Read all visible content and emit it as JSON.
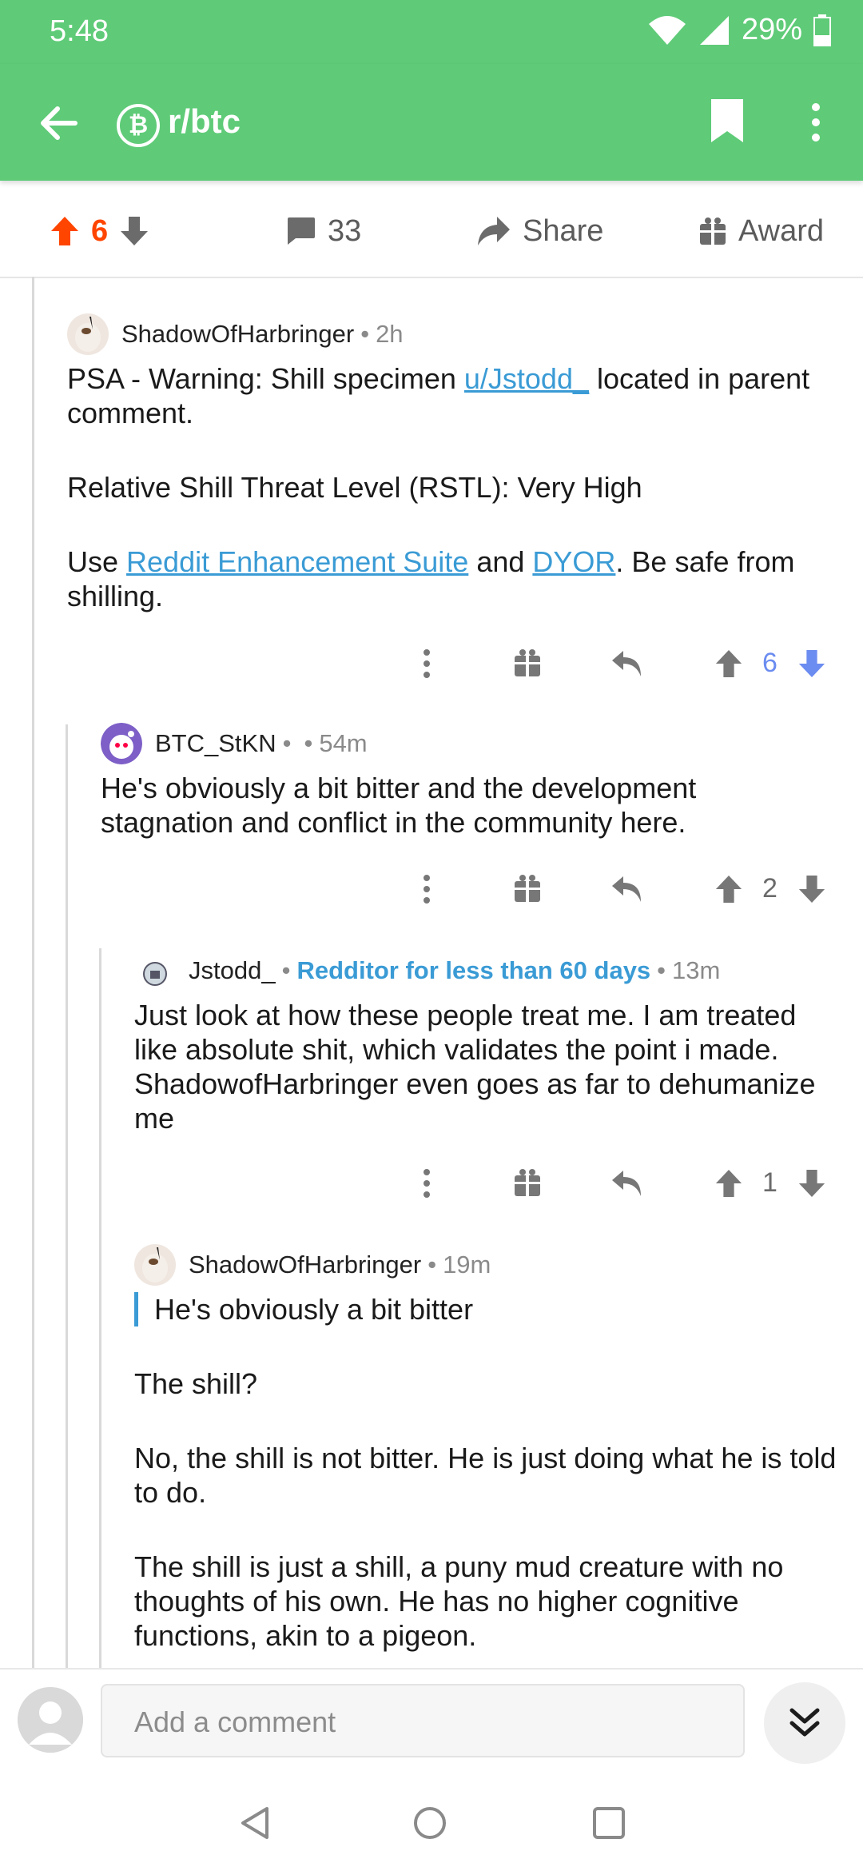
{
  "status_bar": {
    "time": "5:48",
    "battery": "29%"
  },
  "app_bar": {
    "subreddit": "r/btc"
  },
  "post_actions": {
    "votes": "6",
    "comments": "33",
    "share": "Share",
    "award": "Award"
  },
  "comments": [
    {
      "author": "ShadowOfHarbringer",
      "age": "2h",
      "body": {
        "p1_pre": "PSA - Warning: Shill specimen ",
        "p1_link": "u/Jstodd_",
        "p1_post": " located in parent comment.",
        "p2": "Relative Shill Threat Level (RSTL): Very High",
        "p3_pre": "Use ",
        "p3_link1": "Reddit Enhancement Suite",
        "p3_mid": " and ",
        "p3_link2": "DYOR",
        "p3_post": ". Be safe from shilling."
      },
      "score": "6"
    },
    {
      "author": "BTC_StKN",
      "age": "54m",
      "body": "He's obviously a bit bitter and the development stagnation and conflict in the community here.",
      "score": "2"
    },
    {
      "author": "Jstodd_",
      "flair": "Redditor for less than 60 days",
      "age": "13m",
      "body": "Just look at how these people treat me. I am treated like absolute shit, which validates the point i made. ShadowofHarbringer even goes as far to dehumanize me",
      "score": "1"
    },
    {
      "author": "ShadowOfHarbringer",
      "age": "19m",
      "quote": "He's obviously a bit bitter",
      "p1": "The shill?",
      "p2": "No, the shill is not bitter. He is just doing what he is told to do.",
      "p3": "The shill is just a shill, a puny mud creature with no thoughts of his own. He has no higher cognitive functions, akin to a pigeon."
    }
  ],
  "bottom_bar": {
    "placeholder": "Add a comment"
  },
  "colors": {
    "app_green": "#5fcb78",
    "upvote_orange": "#ff4500",
    "downvote_blue": "#6b8cf0",
    "link_blue": "#3a9bd5"
  }
}
